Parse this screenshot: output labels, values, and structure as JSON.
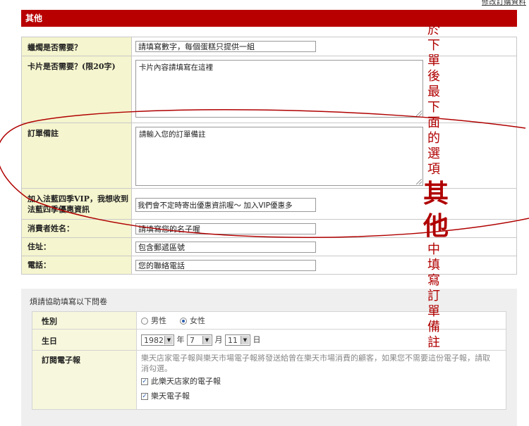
{
  "top_link": "修改訂購資料",
  "section": {
    "title": "其他"
  },
  "form": {
    "candles": {
      "label": "蠟燭是否需要？",
      "value": "請填寫數字，每個蛋糕只提供一組"
    },
    "card": {
      "label": "卡片是否需要？(限20字)",
      "value": "卡片內容請填寫在這裡"
    },
    "order_note": {
      "label": "訂單備註",
      "value": "請輸入您的訂單備註"
    },
    "vip": {
      "label": "加入法藍四季VIP，我想收到法藍四季優惠資訊",
      "value": "我們會不定時寄出優惠資訊喔～ 加入VIP優惠多"
    },
    "name": {
      "label": "消費者姓名：",
      "value": "請填寫您的名子喔"
    },
    "address": {
      "label": "住址：",
      "value": "包含郵遞區號"
    },
    "phone": {
      "label": "電話：",
      "value": "您的聯絡電話"
    }
  },
  "survey": {
    "title": "煩請協助填寫以下問卷",
    "gender": {
      "label": "性別",
      "male": "男性",
      "female": "女性",
      "selected": "female"
    },
    "birthday": {
      "label": "生日",
      "year": "1982",
      "year_unit": "年",
      "month": "7",
      "month_unit": "月",
      "day": "11",
      "day_unit": "日"
    },
    "newsletter": {
      "label": "訂閱電子報",
      "description": "樂天店家電子報與樂天市場電子報將發送給曾在樂天市場消費的顧客，如果您不需要這份電子報，請取消勾選。",
      "option1": "此樂天店家的電子報",
      "option2": "樂天電子報"
    }
  },
  "annotation": {
    "chars": [
      "於",
      "下",
      "單",
      "後",
      "最",
      "下",
      "面",
      "的",
      "選",
      "項",
      "其",
      "他",
      "中",
      "填",
      "寫",
      "訂",
      "單",
      "備",
      "註"
    ],
    "color": "#b00000"
  }
}
